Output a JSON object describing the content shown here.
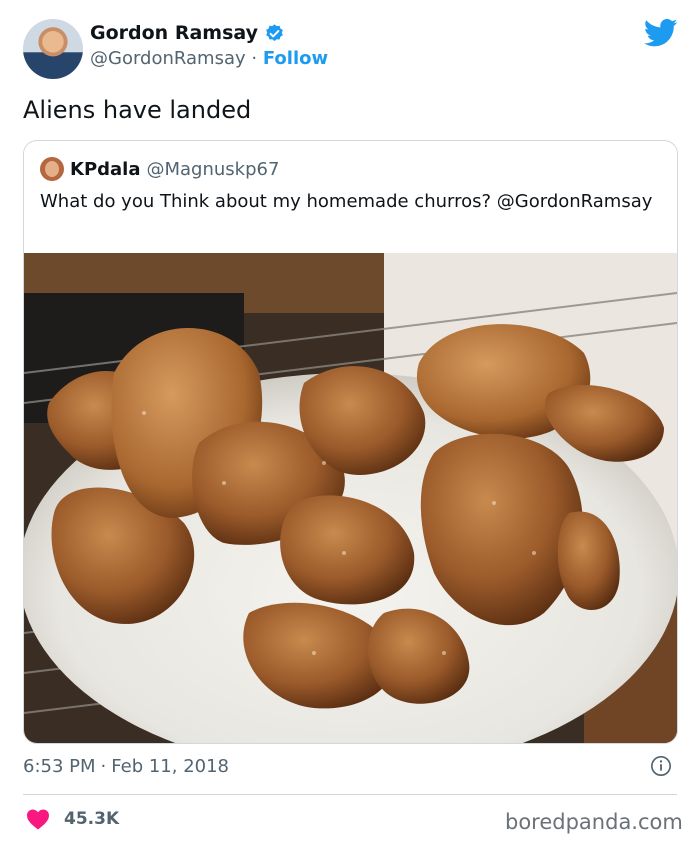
{
  "author": {
    "name": "Gordon Ramsay",
    "handle": "@GordonRamsay",
    "separator": "·",
    "follow_label": "Follow"
  },
  "tweet": {
    "text": "Aliens have landed",
    "time": "6:53 PM",
    "separator": "·",
    "date": "Feb 11, 2018",
    "likes": "45.3K"
  },
  "quoted": {
    "name": "KPdala",
    "handle": "@Magnuskp67",
    "text": "What do you Think about my homemade churros? @GordonRamsay"
  },
  "watermark": "boredpanda.com",
  "colors": {
    "accent": "#1d9bf0",
    "heart": "#f91880",
    "muted": "#536471"
  },
  "icons": [
    "verified-badge-icon",
    "twitter-bird-icon",
    "info-icon",
    "heart-icon"
  ]
}
